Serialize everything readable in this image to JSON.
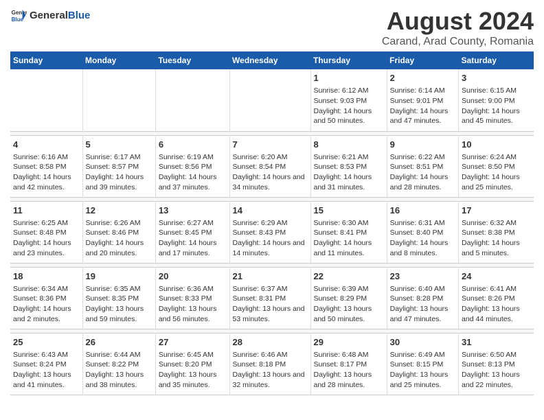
{
  "logo": {
    "general": "General",
    "blue": "Blue"
  },
  "title": "August 2024",
  "subtitle": "Carand, Arad County, Romania",
  "days_of_week": [
    "Sunday",
    "Monday",
    "Tuesday",
    "Wednesday",
    "Thursday",
    "Friday",
    "Saturday"
  ],
  "weeks": [
    [
      {
        "day": "",
        "content": ""
      },
      {
        "day": "",
        "content": ""
      },
      {
        "day": "",
        "content": ""
      },
      {
        "day": "",
        "content": ""
      },
      {
        "day": "1",
        "sunrise": "6:12 AM",
        "sunset": "9:03 PM",
        "daylight": "14 hours and 50 minutes."
      },
      {
        "day": "2",
        "sunrise": "6:14 AM",
        "sunset": "9:01 PM",
        "daylight": "14 hours and 47 minutes."
      },
      {
        "day": "3",
        "sunrise": "6:15 AM",
        "sunset": "9:00 PM",
        "daylight": "14 hours and 45 minutes."
      }
    ],
    [
      {
        "day": "4",
        "sunrise": "6:16 AM",
        "sunset": "8:58 PM",
        "daylight": "14 hours and 42 minutes."
      },
      {
        "day": "5",
        "sunrise": "6:17 AM",
        "sunset": "8:57 PM",
        "daylight": "14 hours and 39 minutes."
      },
      {
        "day": "6",
        "sunrise": "6:19 AM",
        "sunset": "8:56 PM",
        "daylight": "14 hours and 37 minutes."
      },
      {
        "day": "7",
        "sunrise": "6:20 AM",
        "sunset": "8:54 PM",
        "daylight": "14 hours and 34 minutes."
      },
      {
        "day": "8",
        "sunrise": "6:21 AM",
        "sunset": "8:53 PM",
        "daylight": "14 hours and 31 minutes."
      },
      {
        "day": "9",
        "sunrise": "6:22 AM",
        "sunset": "8:51 PM",
        "daylight": "14 hours and 28 minutes."
      },
      {
        "day": "10",
        "sunrise": "6:24 AM",
        "sunset": "8:50 PM",
        "daylight": "14 hours and 25 minutes."
      }
    ],
    [
      {
        "day": "11",
        "sunrise": "6:25 AM",
        "sunset": "8:48 PM",
        "daylight": "14 hours and 23 minutes."
      },
      {
        "day": "12",
        "sunrise": "6:26 AM",
        "sunset": "8:46 PM",
        "daylight": "14 hours and 20 minutes."
      },
      {
        "day": "13",
        "sunrise": "6:27 AM",
        "sunset": "8:45 PM",
        "daylight": "14 hours and 17 minutes."
      },
      {
        "day": "14",
        "sunrise": "6:29 AM",
        "sunset": "8:43 PM",
        "daylight": "14 hours and 14 minutes."
      },
      {
        "day": "15",
        "sunrise": "6:30 AM",
        "sunset": "8:41 PM",
        "daylight": "14 hours and 11 minutes."
      },
      {
        "day": "16",
        "sunrise": "6:31 AM",
        "sunset": "8:40 PM",
        "daylight": "14 hours and 8 minutes."
      },
      {
        "day": "17",
        "sunrise": "6:32 AM",
        "sunset": "8:38 PM",
        "daylight": "14 hours and 5 minutes."
      }
    ],
    [
      {
        "day": "18",
        "sunrise": "6:34 AM",
        "sunset": "8:36 PM",
        "daylight": "14 hours and 2 minutes."
      },
      {
        "day": "19",
        "sunrise": "6:35 AM",
        "sunset": "8:35 PM",
        "daylight": "13 hours and 59 minutes."
      },
      {
        "day": "20",
        "sunrise": "6:36 AM",
        "sunset": "8:33 PM",
        "daylight": "13 hours and 56 minutes."
      },
      {
        "day": "21",
        "sunrise": "6:37 AM",
        "sunset": "8:31 PM",
        "daylight": "13 hours and 53 minutes."
      },
      {
        "day": "22",
        "sunrise": "6:39 AM",
        "sunset": "8:29 PM",
        "daylight": "13 hours and 50 minutes."
      },
      {
        "day": "23",
        "sunrise": "6:40 AM",
        "sunset": "8:28 PM",
        "daylight": "13 hours and 47 minutes."
      },
      {
        "day": "24",
        "sunrise": "6:41 AM",
        "sunset": "8:26 PM",
        "daylight": "13 hours and 44 minutes."
      }
    ],
    [
      {
        "day": "25",
        "sunrise": "6:43 AM",
        "sunset": "8:24 PM",
        "daylight": "13 hours and 41 minutes."
      },
      {
        "day": "26",
        "sunrise": "6:44 AM",
        "sunset": "8:22 PM",
        "daylight": "13 hours and 38 minutes."
      },
      {
        "day": "27",
        "sunrise": "6:45 AM",
        "sunset": "8:20 PM",
        "daylight": "13 hours and 35 minutes."
      },
      {
        "day": "28",
        "sunrise": "6:46 AM",
        "sunset": "8:18 PM",
        "daylight": "13 hours and 32 minutes."
      },
      {
        "day": "29",
        "sunrise": "6:48 AM",
        "sunset": "8:17 PM",
        "daylight": "13 hours and 28 minutes."
      },
      {
        "day": "30",
        "sunrise": "6:49 AM",
        "sunset": "8:15 PM",
        "daylight": "13 hours and 25 minutes."
      },
      {
        "day": "31",
        "sunrise": "6:50 AM",
        "sunset": "8:13 PM",
        "daylight": "13 hours and 22 minutes."
      }
    ]
  ]
}
